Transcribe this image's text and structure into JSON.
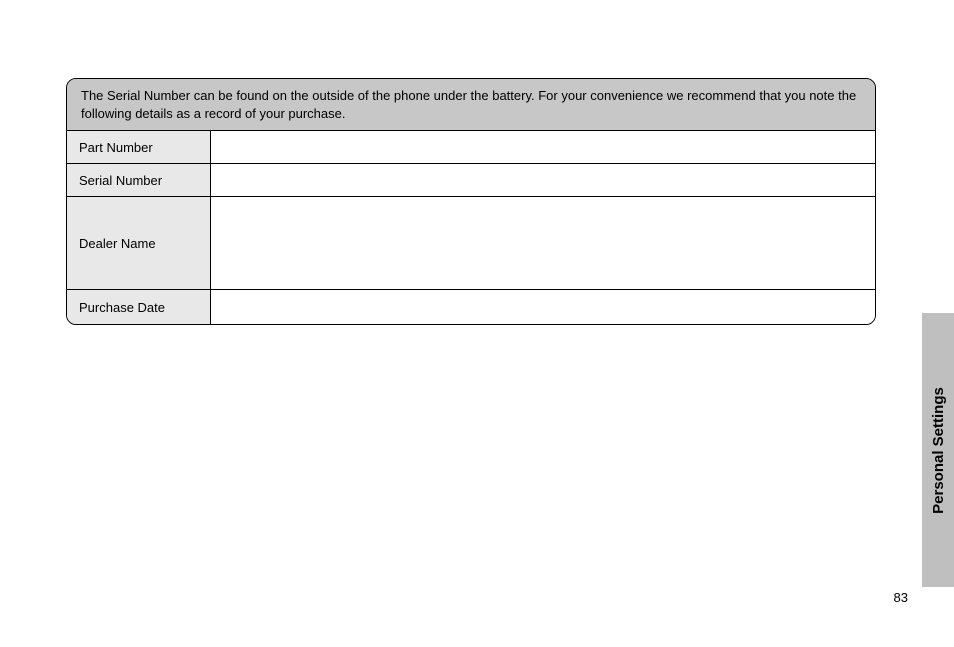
{
  "header": {
    "text": "The Serial Number can be found on the outside of the phone under the battery. For your convenience we recommend that you note the following details as a record of your purchase."
  },
  "rows": {
    "part_number": {
      "label": "Part Number",
      "value": ""
    },
    "serial_number": {
      "label": "Serial Number",
      "value": ""
    },
    "dealer_name": {
      "label": "Dealer Name",
      "value": ""
    },
    "purchase_date": {
      "label": "Purchase Date",
      "value": ""
    }
  },
  "side_tab": {
    "label": "Personal Settings"
  },
  "page_number": "83"
}
